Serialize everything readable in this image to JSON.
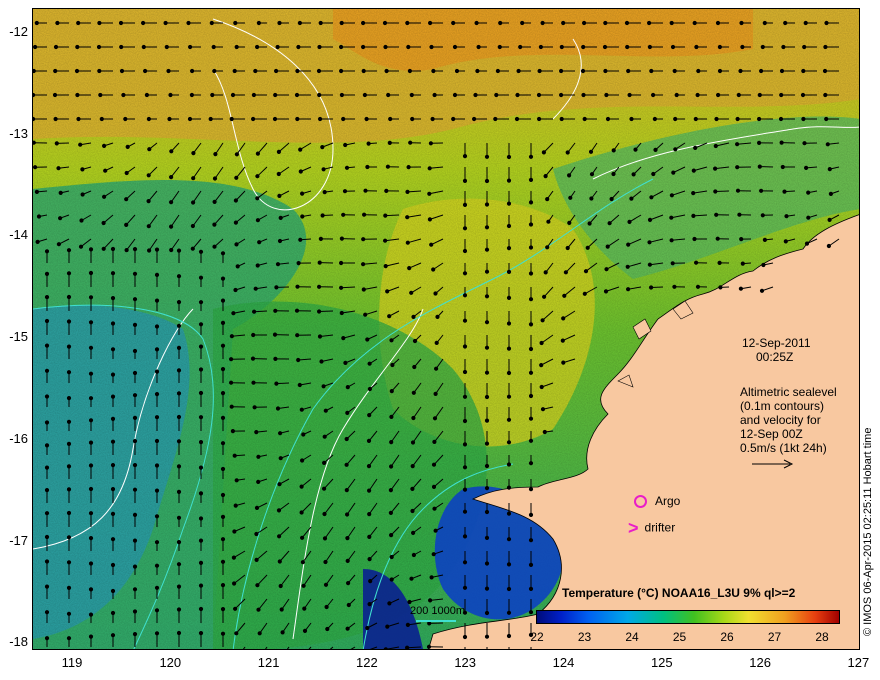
{
  "map": {
    "y_axis_labels": [
      "-12",
      "-13",
      "-14",
      "-15",
      "-16",
      "-17",
      "-18"
    ],
    "x_axis_labels": [
      "119",
      "120",
      "121",
      "122",
      "123",
      "124",
      "125",
      "126",
      "127"
    ],
    "date_label": "12-Sep-2011",
    "time_label": "00:25Z",
    "altimetry_note": "Altimetric sealevel\n(0.1m contours)\nand velocity for\n12-Sep 00Z\n0.5m/s (1kt 24h)",
    "argo_label": "Argo",
    "drifter_label": "drifter",
    "colorbar_title": "Temperature (°C) NOAA16_L3U 9% ql>=2",
    "colorbar_ticks": [
      "22",
      "23",
      "24",
      "25",
      "26",
      "27",
      "28"
    ],
    "depth_legend": "200  1000m",
    "credit": "© IMOS 06-Apr-2015 02:25:11 Hobart time",
    "colors": {
      "land": "#f8c8a0",
      "arrow": "#000000",
      "contour_white": "#ffffff",
      "contour_cyan": "#40e0d0",
      "marker": "#e91ec8"
    },
    "icons": [
      "argo-circle-icon",
      "drifter-chevron-icon",
      "scale-arrow-icon"
    ]
  }
}
